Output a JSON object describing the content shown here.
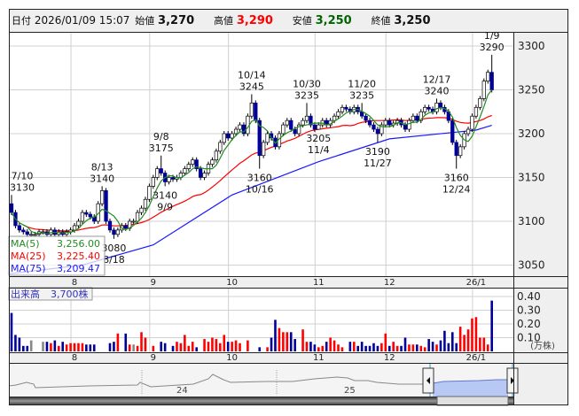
{
  "header": {
    "date_label": "日付",
    "datetime": "2026/01/09 15:07",
    "open_label": "始値",
    "open": "3,270",
    "high_label": "高値",
    "high": "3,290",
    "low_label": "安値",
    "low": "3,250",
    "close_label": "終値",
    "close": "3,250"
  },
  "colors": {
    "high": "#ff0000",
    "low": "#006600",
    "down_candle": "#000099",
    "up_candle": "#ffffff",
    "ma5": "#228b22",
    "ma25": "#ff0000",
    "ma75": "#1a1aff",
    "vol_up": "#ff0000",
    "vol_down": "#000099",
    "vol_flat": "#888888"
  },
  "legend": {
    "ma5_label": "MA(5)",
    "ma5_value": "3,256.00",
    "ma25_label": "MA(25)",
    "ma25_value": "3,225.40",
    "ma75_label": "MA(75)",
    "ma75_value": "3,209.47"
  },
  "volume_legend": {
    "label": "出来高",
    "value": "3,700株"
  },
  "navigator": {
    "year_labels": [
      "24",
      "25"
    ]
  },
  "chart_data": {
    "type": "candlestick",
    "price_axis": {
      "ticks": [
        "3300",
        "3250",
        "3200",
        "3150",
        "3100",
        "3050"
      ],
      "ylim": [
        3035,
        3315
      ]
    },
    "volume_axis": {
      "ticks": [
        "0.40",
        "0.30",
        "0.20",
        "0.10"
      ],
      "unit": "(万株)",
      "ylim": [
        0,
        0.42
      ]
    },
    "months": [
      {
        "label": "8",
        "start_index": 16
      },
      {
        "label": "9",
        "start_index": 36
      },
      {
        "label": "10",
        "start_index": 56
      },
      {
        "label": "11",
        "start_index": 78
      },
      {
        "label": "12",
        "start_index": 96
      },
      {
        "label": "26/1",
        "start_index": 118
      }
    ],
    "first_open": 3120,
    "close": [
      3110,
      3095,
      3090,
      3088,
      3085,
      3085,
      3085,
      3088,
      3088,
      3085,
      3090,
      3085,
      3088,
      3085,
      3088,
      3090,
      3095,
      3100,
      3110,
      3108,
      3105,
      3100,
      3120,
      3135,
      3100,
      3090,
      3085,
      3090,
      3095,
      3092,
      3100,
      3100,
      3110,
      3115,
      3125,
      3140,
      3150,
      3160,
      3155,
      3145,
      3150,
      3148,
      3150,
      3155,
      3160,
      3165,
      3170,
      3160,
      3150,
      3155,
      3165,
      3170,
      3180,
      3190,
      3200,
      3195,
      3200,
      3205,
      3210,
      3200,
      3220,
      3235,
      3215,
      3175,
      3190,
      3200,
      3195,
      3185,
      3200,
      3210,
      3215,
      3205,
      3200,
      3210,
      3215,
      3220,
      3210,
      3205,
      3210,
      3215,
      3210,
      3215,
      3220,
      3225,
      3230,
      3228,
      3225,
      3230,
      3225,
      3220,
      3215,
      3210,
      3205,
      3200,
      3210,
      3215,
      3210,
      3212,
      3215,
      3210,
      3205,
      3215,
      3220,
      3215,
      3225,
      3230,
      3228,
      3225,
      3235,
      3230,
      3225,
      3215,
      3190,
      3175,
      3185,
      3200,
      3205,
      3220,
      3230,
      3240,
      3260,
      3270,
      3250
    ],
    "volume": [
      0.28,
      0.12,
      0.1,
      0.04,
      0.04,
      0.08,
      0,
      0,
      0.07,
      0.07,
      0.06,
      0.08,
      0.04,
      0.07,
      0.05,
      0.06,
      0.06,
      0.06,
      0.06,
      0.05,
      0.05,
      0.05,
      0,
      0,
      0,
      0.06,
      0.07,
      0.13,
      0,
      0.13,
      0.05,
      0.05,
      0.04,
      0.14,
      0.1,
      0,
      0.04,
      0,
      0.07,
      0.06,
      0,
      0.04,
      0.07,
      0.06,
      0.12,
      0.04,
      0.07,
      0.03,
      0,
      0.09,
      0.07,
      0.1,
      0.09,
      0.06,
      0.12,
      0.07,
      0.07,
      0.08,
      0.06,
      0,
      0.08,
      0,
      0,
      0.03,
      0,
      0.03,
      0.1,
      0.23,
      0.17,
      0.14,
      0.14,
      0.14,
      0.09,
      0,
      0.16,
      0.07,
      0.07,
      0.05,
      0.03,
      0.04,
      0.07,
      0.1,
      0.08,
      0.05,
      0.03,
      0,
      0.07,
      0.07,
      0.04,
      0.07,
      0.04,
      0.04,
      0.06,
      0.04,
      0.06,
      0.13,
      0.04,
      0.07,
      0.04,
      0.04,
      0.1,
      0.05,
      0.05,
      0.05,
      0.04,
      0.03,
      0.09,
      0.07,
      0.05,
      0.08,
      0.15,
      0.06,
      0.14,
      0.06,
      0.18,
      0.12,
      0.16,
      0.24,
      0.25,
      0.1,
      0.1,
      0.05,
      0.37
    ],
    "ma75_points": [
      [
        18,
        3050
      ],
      [
        36,
        3073
      ],
      [
        56,
        3130
      ],
      [
        78,
        3168
      ],
      [
        96,
        3194
      ],
      [
        118,
        3204
      ],
      [
        122,
        3209.47
      ]
    ],
    "annotations": [
      {
        "index": 0,
        "date": "7/10",
        "price": 3130,
        "kind": "high"
      },
      {
        "index": 23,
        "date": "8/13",
        "price": 3140,
        "kind": "high"
      },
      {
        "index": 26,
        "date": "8/18",
        "price": 3080,
        "kind": "low"
      },
      {
        "index": 38,
        "date": "9/8",
        "price": 3175,
        "kind": "high"
      },
      {
        "index": 39,
        "date": "9/9",
        "price": 3140,
        "kind": "low"
      },
      {
        "index": 61,
        "date": "10/14",
        "price": 3245,
        "kind": "high"
      },
      {
        "index": 63,
        "date": "10/16",
        "price": 3160,
        "kind": "low"
      },
      {
        "index": 75,
        "date": "10/30",
        "price": 3235,
        "kind": "high"
      },
      {
        "index": 78,
        "date": "11/4",
        "price": 3205,
        "kind": "low"
      },
      {
        "index": 89,
        "date": "11/20",
        "price": 3235,
        "kind": "high"
      },
      {
        "index": 93,
        "date": "11/27",
        "price": 3190,
        "kind": "low"
      },
      {
        "index": 108,
        "date": "12/17",
        "price": 3240,
        "kind": "high"
      },
      {
        "index": 113,
        "date": "12/24",
        "price": 3160,
        "kind": "low"
      },
      {
        "index": 122,
        "date": "1/9",
        "price": 3290,
        "kind": "high"
      }
    ]
  }
}
